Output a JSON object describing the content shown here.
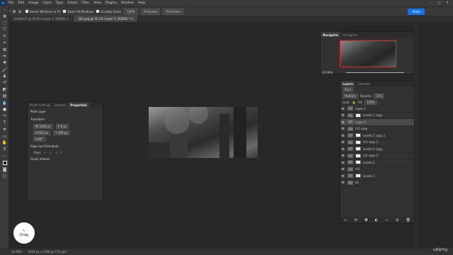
{
  "menubar": {
    "logo": "Ps",
    "items": [
      "File",
      "Edit",
      "Image",
      "Layer",
      "Type",
      "Select",
      "Filter",
      "View",
      "Plugins",
      "Window",
      "Help"
    ],
    "window_controls": [
      "–",
      "□",
      "✕"
    ]
  },
  "options": {
    "resize_label": "Resize Windows to Fit",
    "zoom_all_label": "Zoom All Windows",
    "scrubby_label": "Scrubby Zoom",
    "zoom_value": "100%",
    "fit_label": "Fit Screen",
    "fill_label": "Fill Screen",
    "share_label": "Share"
  },
  "tabs": [
    {
      "label": "Untitled-1 @ 78.8% (Layer 2, RGB/8) ×"
    },
    {
      "label": "3d1.png @ 32.1% (Layer 2, RGB/8) * ×"
    }
  ],
  "navigator": {
    "tabs": [
      "Navigator",
      "Histogram"
    ],
    "zoom": "32.09%"
  },
  "properties": {
    "tabs": [
      "Brush Settings",
      "Brushes",
      "Properties"
    ],
    "kind": "Pixel Layer",
    "transform_title": "Transform",
    "w": "W 3328 px",
    "x": "X 0 px",
    "h": "H 625 px",
    "y": "Y 199 px",
    "angle": "0.00°",
    "align_title": "Align and Distribute",
    "align_label": "Align:",
    "quick_title": "Quick Actions"
  },
  "layers": {
    "tabs": [
      "Layers",
      "Channels"
    ],
    "kind": "Kind",
    "blend": "Multiply",
    "opacity_label": "Opacity:",
    "opacity": "31%",
    "lock_label": "Lock:",
    "fill_label": "Fill:",
    "fill": "100%",
    "rows": [
      {
        "name": "Layer 1",
        "sel": false,
        "mask": false
      },
      {
        "name": "Levels 1 copy",
        "sel": false,
        "mask": true
      },
      {
        "name": "Layer 2",
        "sel": true,
        "mask": false
      },
      {
        "name": "m1 copy",
        "sel": false,
        "mask": false
      },
      {
        "name": "Levels 2 copy 2",
        "sel": false,
        "mask": true
      },
      {
        "name": "m1 copy 3",
        "sel": false,
        "mask": true
      },
      {
        "name": "Levels 2 copy",
        "sel": false,
        "mask": true
      },
      {
        "name": "m1 copy 2",
        "sel": false,
        "mask": true
      },
      {
        "name": "Levels 2",
        "sel": false,
        "mask": true
      },
      {
        "name": "m1",
        "sel": false,
        "mask": false
      },
      {
        "name": "Levels 1",
        "sel": false,
        "mask": true
      },
      {
        "name": "b1",
        "sel": false,
        "mask": false
      }
    ],
    "footer_icons": [
      "link-icon",
      "fx-icon",
      "mask-icon",
      "adjustment-icon",
      "group-icon",
      "new-layer-icon",
      "trash-icon"
    ]
  },
  "status": {
    "zoom": "32.09%",
    "size": "3328 px x 1056 px (72 ppi)"
  },
  "drag": {
    "label": "Drag"
  },
  "watermark": "udemy"
}
